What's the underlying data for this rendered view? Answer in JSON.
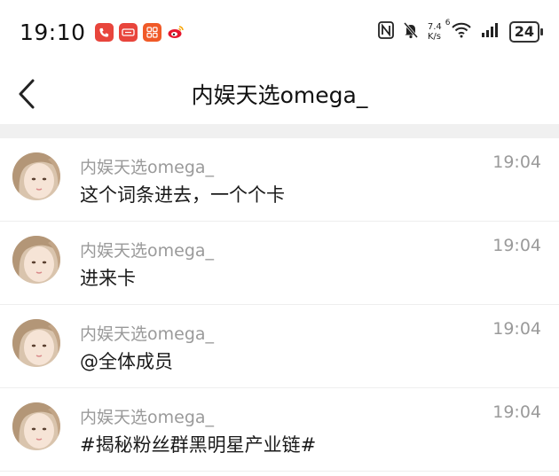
{
  "status_bar": {
    "time": "19:10",
    "network_speed_value": "7.4",
    "network_speed_unit": "K/s",
    "wifi_badge": "6",
    "battery": "24",
    "app_icons": [
      {
        "name": "phone-app-icon",
        "color": "#e8453c"
      },
      {
        "name": "news-app-icon",
        "color": "#e8453c"
      },
      {
        "name": "apps-grid-icon",
        "color": "#f05a28"
      },
      {
        "name": "weibo-icon",
        "color": "#f7a300"
      }
    ]
  },
  "nav": {
    "title": "内娱天选omega_"
  },
  "messages": [
    {
      "sender": "内娱天选omega_",
      "content": "这个词条进去，一个个卡",
      "time": "19:04"
    },
    {
      "sender": "内娱天选omega_",
      "content": "进来卡",
      "time": "19:04"
    },
    {
      "sender": "内娱天选omega_",
      "content": "@全体成员",
      "time": "19:04"
    },
    {
      "sender": "内娱天选omega_",
      "content": "#揭秘粉丝群黑明星产业链#",
      "time": "19:04"
    }
  ]
}
